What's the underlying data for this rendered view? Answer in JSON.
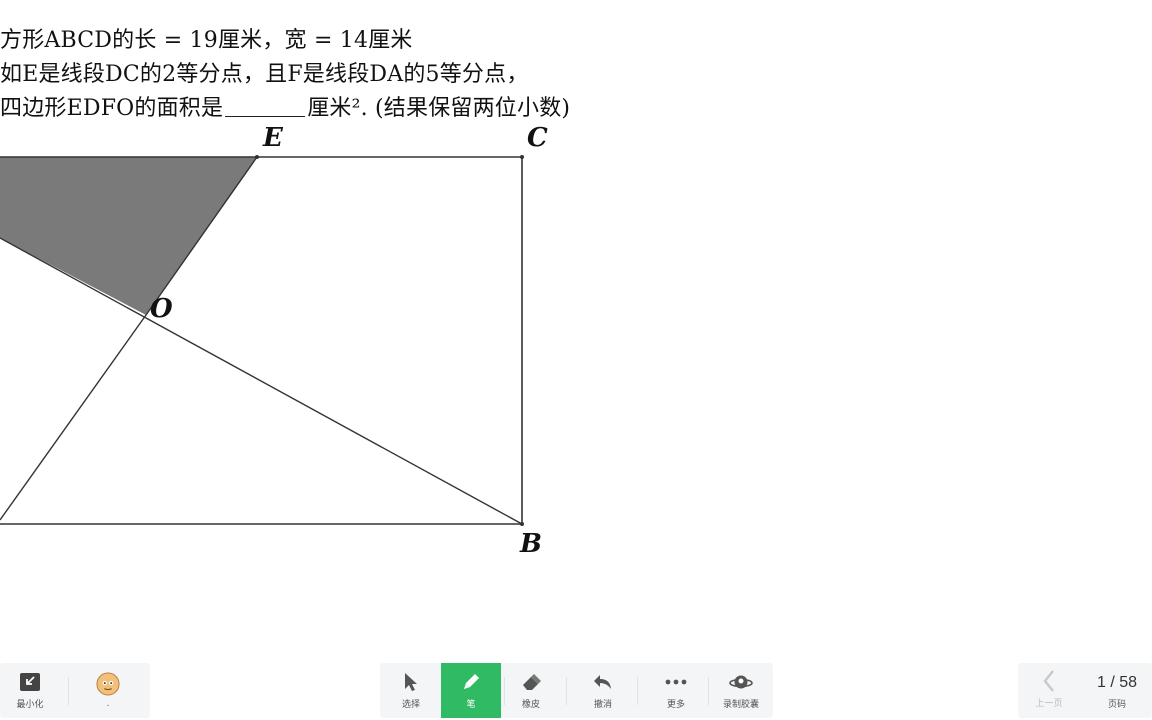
{
  "problem": {
    "line1": "方形ABCD的长 = 19厘米，宽 = 14厘米",
    "line2": "如E是线段DC的2等分点，且F是线段DA的5等分点，",
    "line3_before": "四边形EDFO的面积是",
    "line3_after": "厘米². (结果保留两位小数)"
  },
  "figure": {
    "labels": {
      "E": "E",
      "C": "C",
      "O": "O",
      "B": "B"
    },
    "shade_color": "#7a7a7a",
    "line_color": "#333333"
  },
  "toolbar": {
    "minimize_label": "最小化",
    "avatar_label": ".",
    "tools": [
      {
        "id": "select",
        "label": "选择",
        "icon": "cursor-icon",
        "active": false
      },
      {
        "id": "pen",
        "label": "笔",
        "icon": "pen-icon",
        "active": true
      },
      {
        "id": "eraser",
        "label": "橡皮",
        "icon": "eraser-icon",
        "active": false
      },
      {
        "id": "undo",
        "label": "撤消",
        "icon": "undo-icon",
        "active": false
      },
      {
        "id": "more",
        "label": "更多",
        "icon": "more-icon",
        "active": false
      },
      {
        "id": "record",
        "label": "录制胶囊",
        "icon": "record-capsule-icon",
        "active": false
      }
    ],
    "prev_label": "上一页",
    "page_current": "1",
    "page_separator": " / ",
    "page_total": "58",
    "page_label": "页码",
    "accent_color": "#2fba63"
  }
}
